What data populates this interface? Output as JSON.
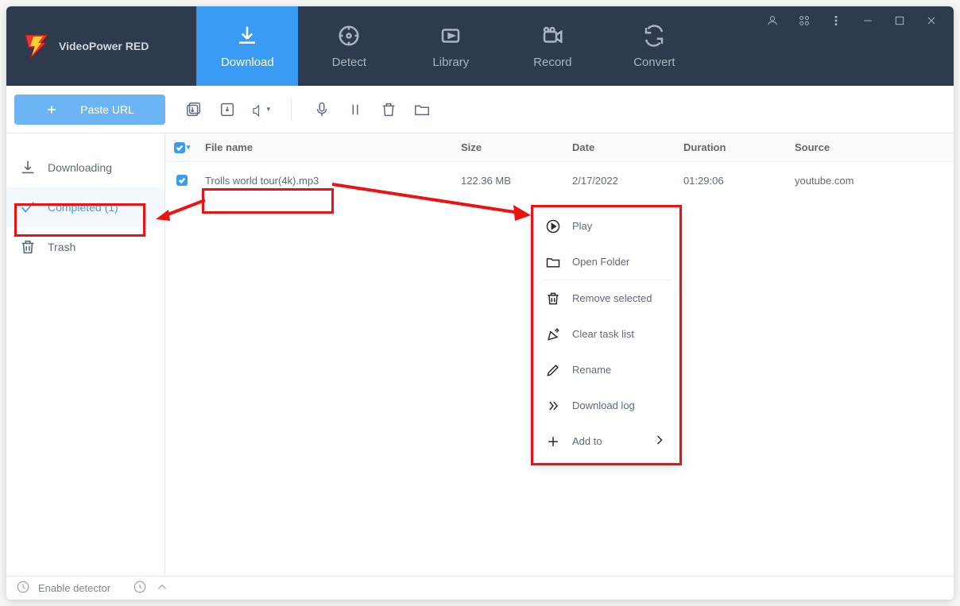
{
  "app": {
    "name": "VideoPower RED"
  },
  "tabs": [
    {
      "label": "Download"
    },
    {
      "label": "Detect"
    },
    {
      "label": "Library"
    },
    {
      "label": "Record"
    },
    {
      "label": "Convert"
    }
  ],
  "toolbar": {
    "paste_label": "Paste URL"
  },
  "sidebar": {
    "downloading": "Downloading",
    "completed": "Completed (1)",
    "trash": "Trash"
  },
  "columns": {
    "name": "File name",
    "size": "Size",
    "date": "Date",
    "duration": "Duration",
    "source": "Source"
  },
  "row": {
    "name": "Trolls world tour(4k).mp3",
    "size": "122.36 MB",
    "date": "2/17/2022",
    "duration": "01:29:06",
    "source": "youtube.com"
  },
  "ctx": {
    "play": "Play",
    "open_folder": "Open Folder",
    "remove_selected": "Remove selected",
    "clear_task_list": "Clear task list",
    "rename": "Rename",
    "download_log": "Download log",
    "add_to": "Add to"
  },
  "status": {
    "detector": "Enable detector"
  }
}
